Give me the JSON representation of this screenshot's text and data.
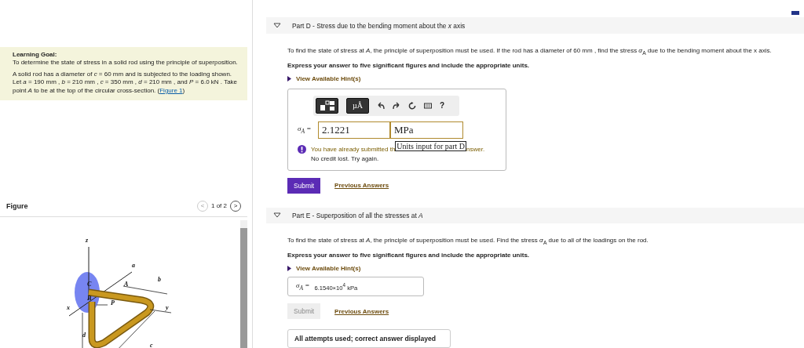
{
  "learning_goal": {
    "title": "Learning Goal:",
    "text": "To determine the state of stress in a solid rod using the principle of superposition.",
    "problem": "A solid rod has a diameter of *c* = 60 mm and is subjected to the loading shown. Let *a* = 190 mm , *b* = 210 mm , *c* = 350 mm , *d* = 210 mm , and *P* = 6.0 kN . Take point *A* to be at the top of the circular cross-section. (",
    "figure_link": "Figure 1",
    "problem_end": ")"
  },
  "figure": {
    "title": "Figure",
    "prev": "<",
    "counter": "1 of 2",
    "next": ">",
    "labels": [
      {
        "kind": "z",
        "text": "z"
      },
      {
        "kind": "a",
        "text": "a"
      },
      {
        "kind": "b",
        "text": "b"
      },
      {
        "kind": "c",
        "text": "c"
      },
      {
        "kind": "d",
        "text": "d"
      },
      {
        "kind": "x",
        "text": "x"
      },
      {
        "kind": "y",
        "text": "y"
      },
      {
        "kind": "C",
        "text": "C"
      },
      {
        "kind": "A",
        "text": "A"
      },
      {
        "kind": "B",
        "text": "B"
      },
      {
        "kind": "P",
        "text": "P"
      }
    ]
  },
  "parts": [
    {
      "title": "Part D - Stress due to the bending moment about the *x* axis",
      "expanded": true,
      "text": "To find the state of stress at *A*, the principle of superposition must be used. If the rod has a diameter of 60 mm , find the stress *σ*$_{A}$ due to the bending moment about the x axis.",
      "instruction": "Express your answer to five significant figures and include the appropriate units.",
      "hint": "View Available Hint(s)",
      "answer": {
        "kind": "editor",
        "toolbar": {
          "units_button": "µÅ",
          "help": "?"
        },
        "label": "σ$_{A}$ =",
        "value": "2.1221",
        "units": "MPa",
        "feedback_before": "You have already submitted th",
        "tooltip": "Units input for part D",
        "feedback_after": "nswer.",
        "feedback_line2": "No credit lost. Try again."
      },
      "submit": {
        "label": "Submit",
        "disabled": false
      },
      "previous": "Previous Answers"
    },
    {
      "title": "Part E - Superposition of all the stresses at *A*",
      "expanded": true,
      "text": "To find the state of stress at *A*, the principle of superposition must be used. Find the stress *σ*$_{A}$ due to all of the loadings on the rod.",
      "instruction": "Express your answer to five significant figures and include the appropriate units.",
      "hint": "View Available Hint(s)",
      "answer": {
        "kind": "result",
        "label": "σ$_{A}$ =",
        "value": "6.1540×10$^{4}$ kPa"
      },
      "submit": {
        "label": "Submit",
        "disabled": true
      },
      "previous": "Previous Answers",
      "status": "All attempts used; correct answer displayed"
    }
  ]
}
